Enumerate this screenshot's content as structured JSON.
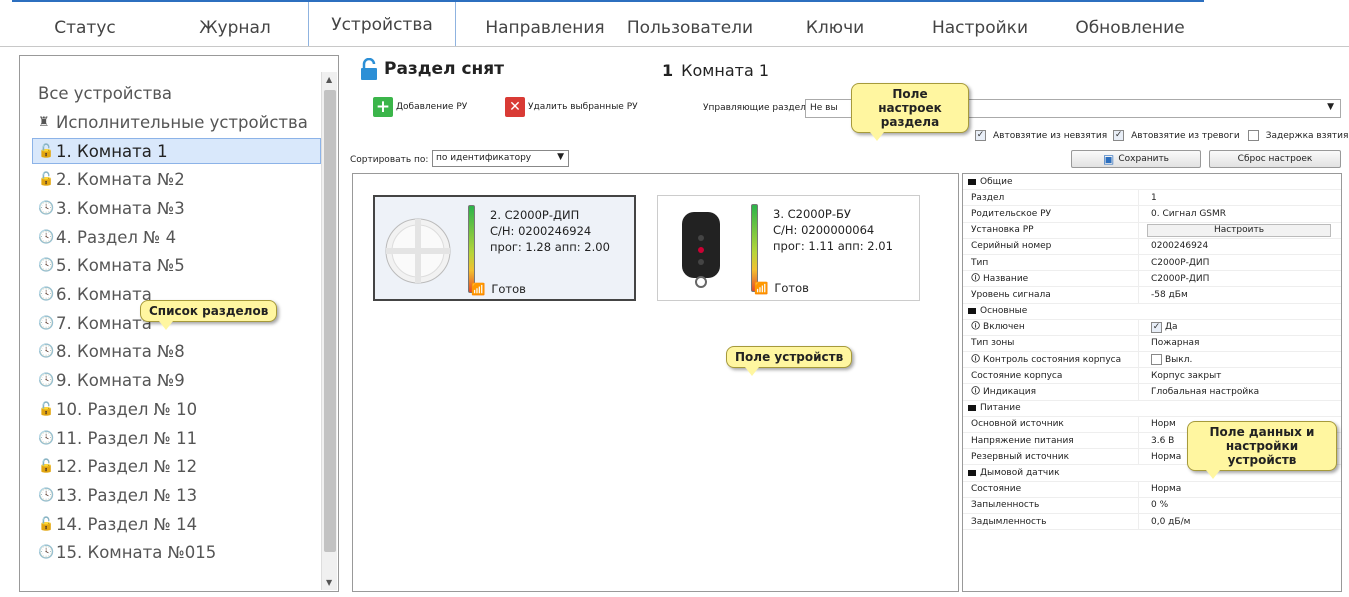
{
  "tabs": [
    "Статус",
    "Журнал",
    "Устройства",
    "Направления",
    "Пользователи",
    "Ключи",
    "Настройки",
    "Обновление"
  ],
  "active_tab": "Устройства",
  "sidebar": {
    "all_devices": "Все устройства",
    "executive_devices": "Исполнительные устройства",
    "items": [
      {
        "label": "1. Комната 1",
        "icon": "lock-open-icon",
        "selected": true
      },
      {
        "label": "2. Комната №2",
        "icon": "lock-open-icon"
      },
      {
        "label": "3. Комната №3",
        "icon": "clock-icon"
      },
      {
        "label": "4. Раздел № 4",
        "icon": "clock-icon"
      },
      {
        "label": "5. Комната №5",
        "icon": "clock-icon"
      },
      {
        "label": "6. Комната",
        "icon": "clock-icon"
      },
      {
        "label": "7. Комната",
        "icon": "clock-icon"
      },
      {
        "label": "8. Комната №8",
        "icon": "clock-icon"
      },
      {
        "label": "9. Комната №9",
        "icon": "clock-icon"
      },
      {
        "label": "10. Раздел № 10",
        "icon": "lock-open-icon"
      },
      {
        "label": "11. Раздел № 11",
        "icon": "clock-icon"
      },
      {
        "label": "12. Раздел № 12",
        "icon": "lock-open-icon"
      },
      {
        "label": "13. Раздел № 13",
        "icon": "clock-icon"
      },
      {
        "label": "14. Раздел № 14",
        "icon": "lock-open-icon"
      },
      {
        "label": "15. Комната №015",
        "icon": "clock-icon"
      }
    ]
  },
  "header": {
    "status": "Раздел снят",
    "room_number": "1",
    "room_name": "Комната 1"
  },
  "toolbar": {
    "add_label": "Добавление РУ",
    "delete_label": "Удалить выбранные РУ",
    "control_label": "Управляющие разделы:",
    "control_value": "Не вы",
    "auto_arm_unarmed": "Автовзятие из невзятия",
    "auto_arm_alarm": "Автовзятие из тревоги",
    "arm_delay": "Задержка взятия",
    "save_label": "Сохранить",
    "reset_label": "Сброс настроек",
    "sort_label": "Сортировать по:",
    "sort_value": "по идентификатору"
  },
  "devices": [
    {
      "title": "2. С2000Р-ДИП",
      "serial": "С/Н: 0200246924",
      "versions": "прог: 1.28  апп: 2.00",
      "status": "Готов",
      "level": 0.7
    },
    {
      "title": "3. С2000Р-БУ",
      "serial": "С/Н: 0200000064",
      "versions": "прог: 1.11  апп: 2.01",
      "status": "Готов",
      "level": 0.7
    }
  ],
  "properties": [
    {
      "group": "Общие"
    },
    {
      "k": "Раздел",
      "v": "1"
    },
    {
      "k": "Родительское РУ",
      "v": "0. Сигнал GSMR"
    },
    {
      "k": "Установка РР",
      "button": "Настроить"
    },
    {
      "k": "Серийный номер",
      "v": "0200246924"
    },
    {
      "k": "Тип",
      "v": "С2000Р-ДИП"
    },
    {
      "k": "🛈 Название",
      "v": "С2000Р-ДИП"
    },
    {
      "k": "Уровень сигнала",
      "v": "-58 дБм"
    },
    {
      "group": "Основные"
    },
    {
      "k": "🛈 Включен",
      "v": "Да",
      "check": true
    },
    {
      "k": "Тип зоны",
      "v": "Пожарная"
    },
    {
      "k": "🛈 Контроль состояния корпуса",
      "v": "Выкл.",
      "check": false
    },
    {
      "k": "Состояние корпуса",
      "v": "Корпус закрыт"
    },
    {
      "k": "🛈 Индикация",
      "v": "Глобальная настройка"
    },
    {
      "group": "Питание"
    },
    {
      "k": "Основной источник",
      "v": "Норм"
    },
    {
      "k": "Напряжение питания",
      "v": "3.6 В"
    },
    {
      "k": "Резервный источник",
      "v": "Норма"
    },
    {
      "group": "Дымовой датчик"
    },
    {
      "k": "Состояние",
      "v": "Норма"
    },
    {
      "k": "Запыленность",
      "v": "0 %"
    },
    {
      "k": "Задымленность",
      "v": "0,0 дБ/м"
    }
  ],
  "callouts": {
    "section_settings": "Поле настроек раздела",
    "section_list": "Список разделов",
    "device_field": "Поле устройств",
    "device_data": "Поле данных и настройки устройств"
  }
}
